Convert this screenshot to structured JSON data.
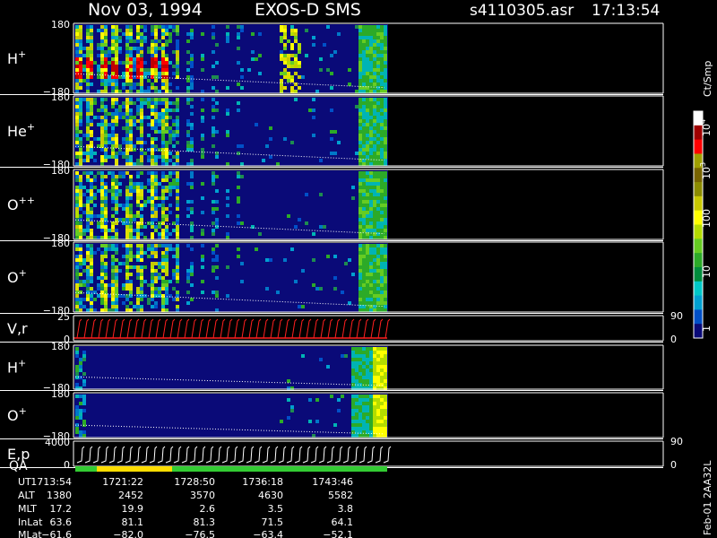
{
  "header": {
    "date": "Nov 03, 1994",
    "instrument": "EXOS-D SMS",
    "file": "s4110305.asr",
    "time": "17:13:54"
  },
  "colorbar": {
    "unit": "Ct/Smp",
    "ticks": [
      "10",
      "10",
      "10",
      "100",
      "10",
      "1"
    ],
    "tick_label_1": "10",
    "tick_sup_1": "4",
    "tick_label_2": "10",
    "tick_sup_2": "3",
    "tick_label_3": "100",
    "tick_label_4": "10",
    "tick_label_5": "1",
    "colors": [
      "#0a0a78",
      "#0050c8",
      "#00a0d0",
      "#00c8c8",
      "#008c3c",
      "#2caa28",
      "#66cc22",
      "#b4dc00",
      "#ffff00",
      "#c8c800",
      "#8c8c00",
      "#786400",
      "#a0a000",
      "#ff0000",
      "#a00000",
      "#ffffff"
    ]
  },
  "panels": [
    {
      "label": "H",
      "sup": "+",
      "ytop": "180",
      "ybot": "−180"
    },
    {
      "label": "He",
      "sup": "+",
      "ytop": "180",
      "ybot": "−180"
    },
    {
      "label": "O",
      "sup": "++",
      "ytop": "180",
      "ybot": "−180"
    },
    {
      "label": "O",
      "sup": "+",
      "ytop": "180",
      "ybot": "−180"
    },
    {
      "label": "V,r",
      "sup": "",
      "ytop": "25",
      "ybot": "0",
      "right_top": "90",
      "right_bot": "0"
    },
    {
      "label": "H",
      "sup": "+",
      "ytop": "180",
      "ybot": "−180"
    },
    {
      "label": "O",
      "sup": "+",
      "ytop": "180",
      "ybot": "−180"
    },
    {
      "label": "E,p",
      "sup": "",
      "ytop": "4000",
      "ybot": "0",
      "right_top": "90",
      "right_bot": "0"
    }
  ],
  "qa_label": "QA",
  "orbit_table": {
    "row_labels": [
      "UT",
      "ALT",
      "MLT",
      "InLat",
      "MLat"
    ],
    "columns": [
      [
        "1713:54",
        "1380",
        "17.2",
        "63.6",
        "−61.6"
      ],
      [
        "1721:22",
        "2452",
        "19.9",
        "81.1",
        "−82.0"
      ],
      [
        "1728:50",
        "3570",
        "2.6",
        "81.3",
        "−76.5"
      ],
      [
        "1736:18",
        "4630",
        "3.5",
        "71.5",
        "−63.4"
      ],
      [
        "1743:46",
        "5582",
        "3.8",
        "64.1",
        "−52.1"
      ]
    ]
  },
  "footer_stamp": "Feb-01 2AA32L",
  "chart_data": {
    "type": "heatmap",
    "title": "Nov 03, 1994   EXOS-D SMS",
    "x_ticks_ut": [
      "1713:54",
      "1721:22",
      "1728:50",
      "1736:18",
      "1743:46"
    ],
    "y_range_angle": [
      -180,
      180
    ],
    "y_range_velocity": [
      0,
      25
    ],
    "y_range_energy": [
      0,
      4000
    ],
    "colorbar_range_ct_per_smp": [
      1,
      10000
    ],
    "colorbar_scale": "log"
  }
}
